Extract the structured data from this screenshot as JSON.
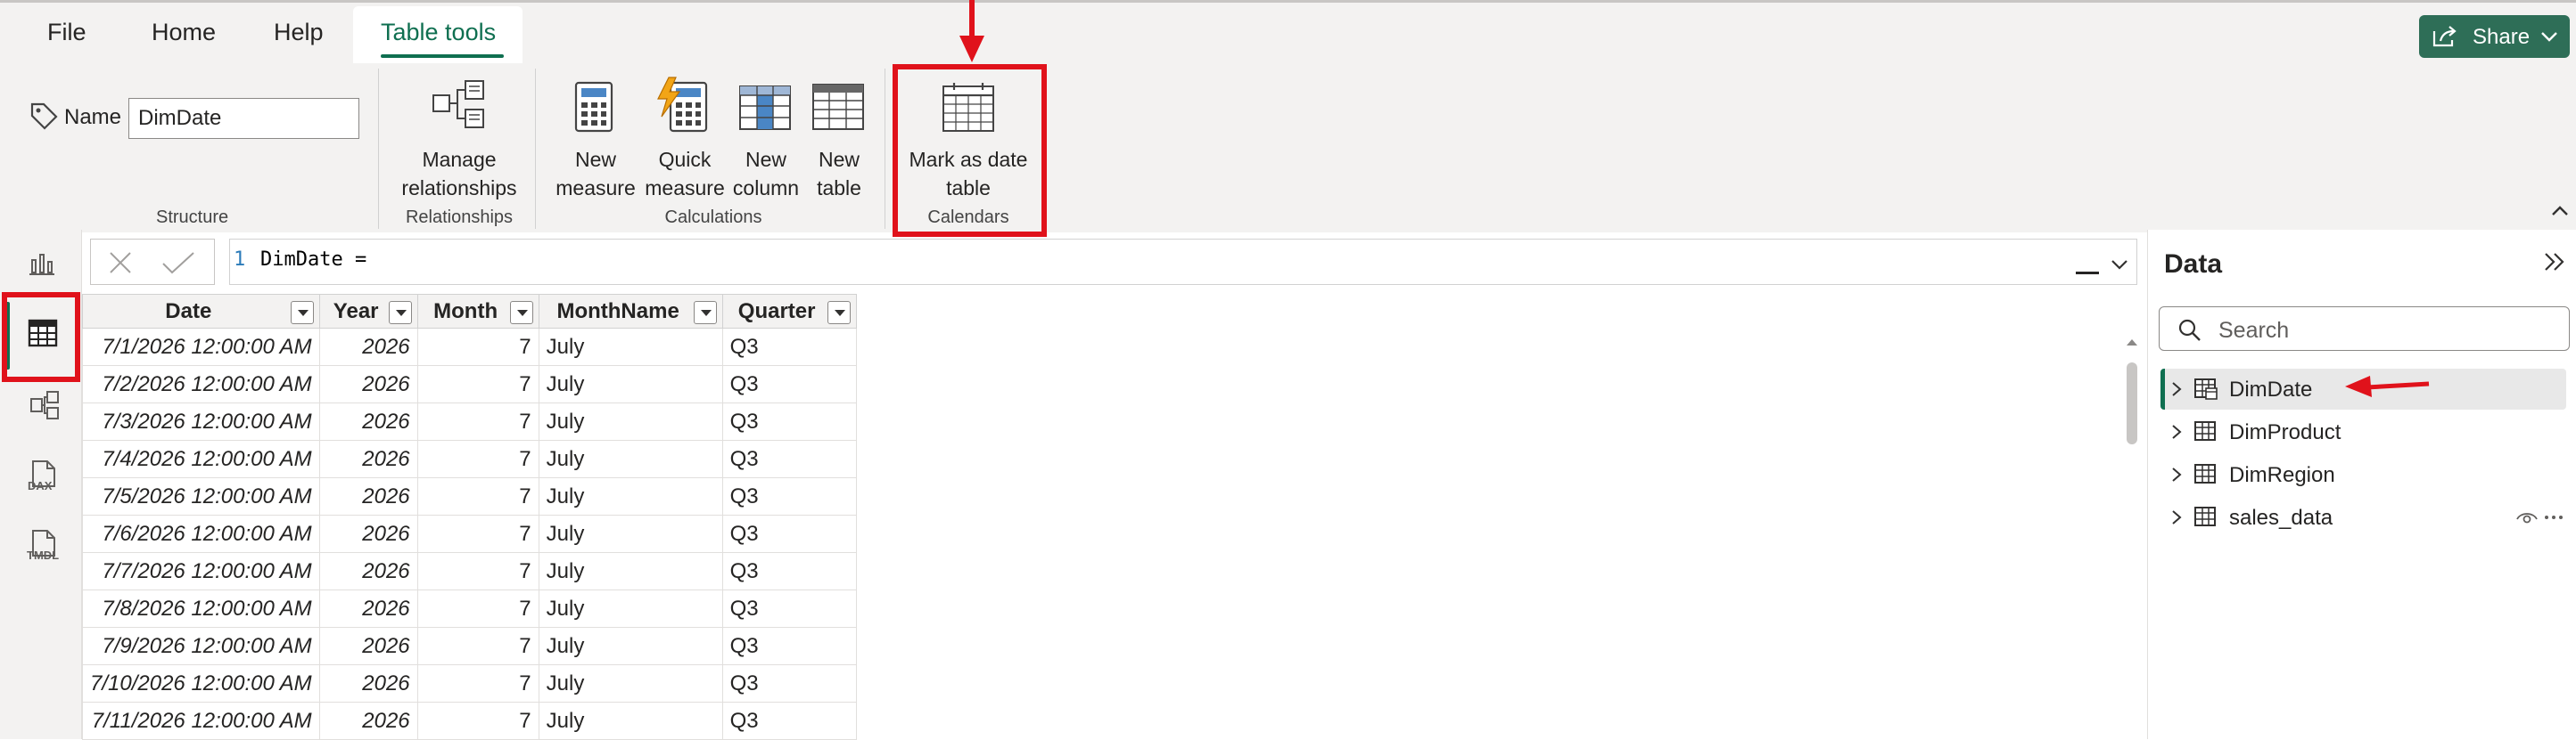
{
  "tabs": [
    {
      "label": "File"
    },
    {
      "label": "Home"
    },
    {
      "label": "Help"
    },
    {
      "label": "Table tools"
    }
  ],
  "share_label": "Share",
  "structure": {
    "name_label": "Name",
    "name_value": "DimDate",
    "group_label": "Structure"
  },
  "relationships": {
    "button": "Manage\nrelationships",
    "line1": "Manage",
    "line2": "relationships",
    "group_label": "Relationships"
  },
  "calculations": {
    "buttons": [
      {
        "line1": "New",
        "line2": "measure"
      },
      {
        "line1": "Quick",
        "line2": "measure"
      },
      {
        "line1": "New",
        "line2": "column"
      },
      {
        "line1": "New",
        "line2": "table"
      }
    ],
    "group_label": "Calculations"
  },
  "calendars": {
    "line1": "Mark as date",
    "line2": "table",
    "group_label": "Calendars"
  },
  "formula": {
    "line_number": "1",
    "text": "DimDate ="
  },
  "rail": {
    "icons": [
      "report-view-icon",
      "table-view-icon",
      "model-view-icon",
      "dax-query-icon",
      "tmdl-view-icon"
    ],
    "dax_label": "DAX",
    "tmdl_label": "TMDL"
  },
  "grid": {
    "columns": [
      "Date",
      "Year",
      "Month",
      "MonthName",
      "Quarter"
    ],
    "rows": [
      [
        "7/1/2026 12:00:00 AM",
        "2026",
        "7",
        "July",
        "Q3"
      ],
      [
        "7/2/2026 12:00:00 AM",
        "2026",
        "7",
        "July",
        "Q3"
      ],
      [
        "7/3/2026 12:00:00 AM",
        "2026",
        "7",
        "July",
        "Q3"
      ],
      [
        "7/4/2026 12:00:00 AM",
        "2026",
        "7",
        "July",
        "Q3"
      ],
      [
        "7/5/2026 12:00:00 AM",
        "2026",
        "7",
        "July",
        "Q3"
      ],
      [
        "7/6/2026 12:00:00 AM",
        "2026",
        "7",
        "July",
        "Q3"
      ],
      [
        "7/7/2026 12:00:00 AM",
        "2026",
        "7",
        "July",
        "Q3"
      ],
      [
        "7/8/2026 12:00:00 AM",
        "2026",
        "7",
        "July",
        "Q3"
      ],
      [
        "7/9/2026 12:00:00 AM",
        "2026",
        "7",
        "July",
        "Q3"
      ],
      [
        "7/10/2026 12:00:00 AM",
        "2026",
        "7",
        "July",
        "Q3"
      ],
      [
        "7/11/2026 12:00:00 AM",
        "2026",
        "7",
        "July",
        "Q3"
      ]
    ]
  },
  "data_pane": {
    "title": "Data",
    "search_placeholder": "Search",
    "items": [
      {
        "label": "DimDate"
      },
      {
        "label": "DimProduct"
      },
      {
        "label": "DimRegion"
      },
      {
        "label": "sales_data"
      }
    ]
  },
  "colors": {
    "accent": "#0f6f50",
    "highlight": "#e0121b",
    "share_bg": "#2e6e57"
  }
}
